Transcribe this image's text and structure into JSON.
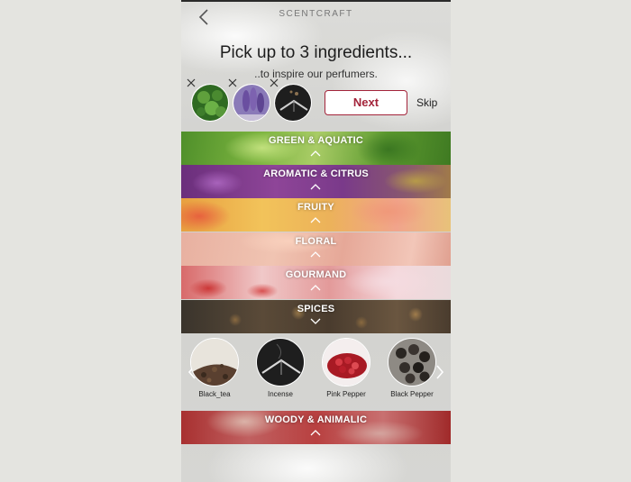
{
  "app": {
    "brand": "SCENTCRAFT",
    "headline": "Pick up to 3 ingredients...",
    "subline": "..to inspire our perfumers."
  },
  "selected": [
    {
      "name": "green herb",
      "color": "#3e7d2c"
    },
    {
      "name": "lavender",
      "color": "#7d62b0"
    },
    {
      "name": "incense",
      "color": "#2c2c2c"
    }
  ],
  "actions": {
    "next_label": "Next",
    "skip_label": "Skip"
  },
  "categories": [
    {
      "label": "GREEN & AQUATIC",
      "expanded": false
    },
    {
      "label": "AROMATIC & CITRUS",
      "expanded": false
    },
    {
      "label": "FRUITY",
      "expanded": false
    },
    {
      "label": "FLORAL",
      "expanded": false
    },
    {
      "label": "GOURMAND",
      "expanded": false
    },
    {
      "label": "SPICES",
      "expanded": true
    },
    {
      "label": "WOODY & ANIMALIC",
      "expanded": false
    }
  ],
  "spice_items": [
    {
      "label": "Black_tea"
    },
    {
      "label": "Incense"
    },
    {
      "label": "Pink Pepper"
    },
    {
      "label": "Black Pepper"
    }
  ],
  "colors": {
    "accent": "#a3243a"
  }
}
